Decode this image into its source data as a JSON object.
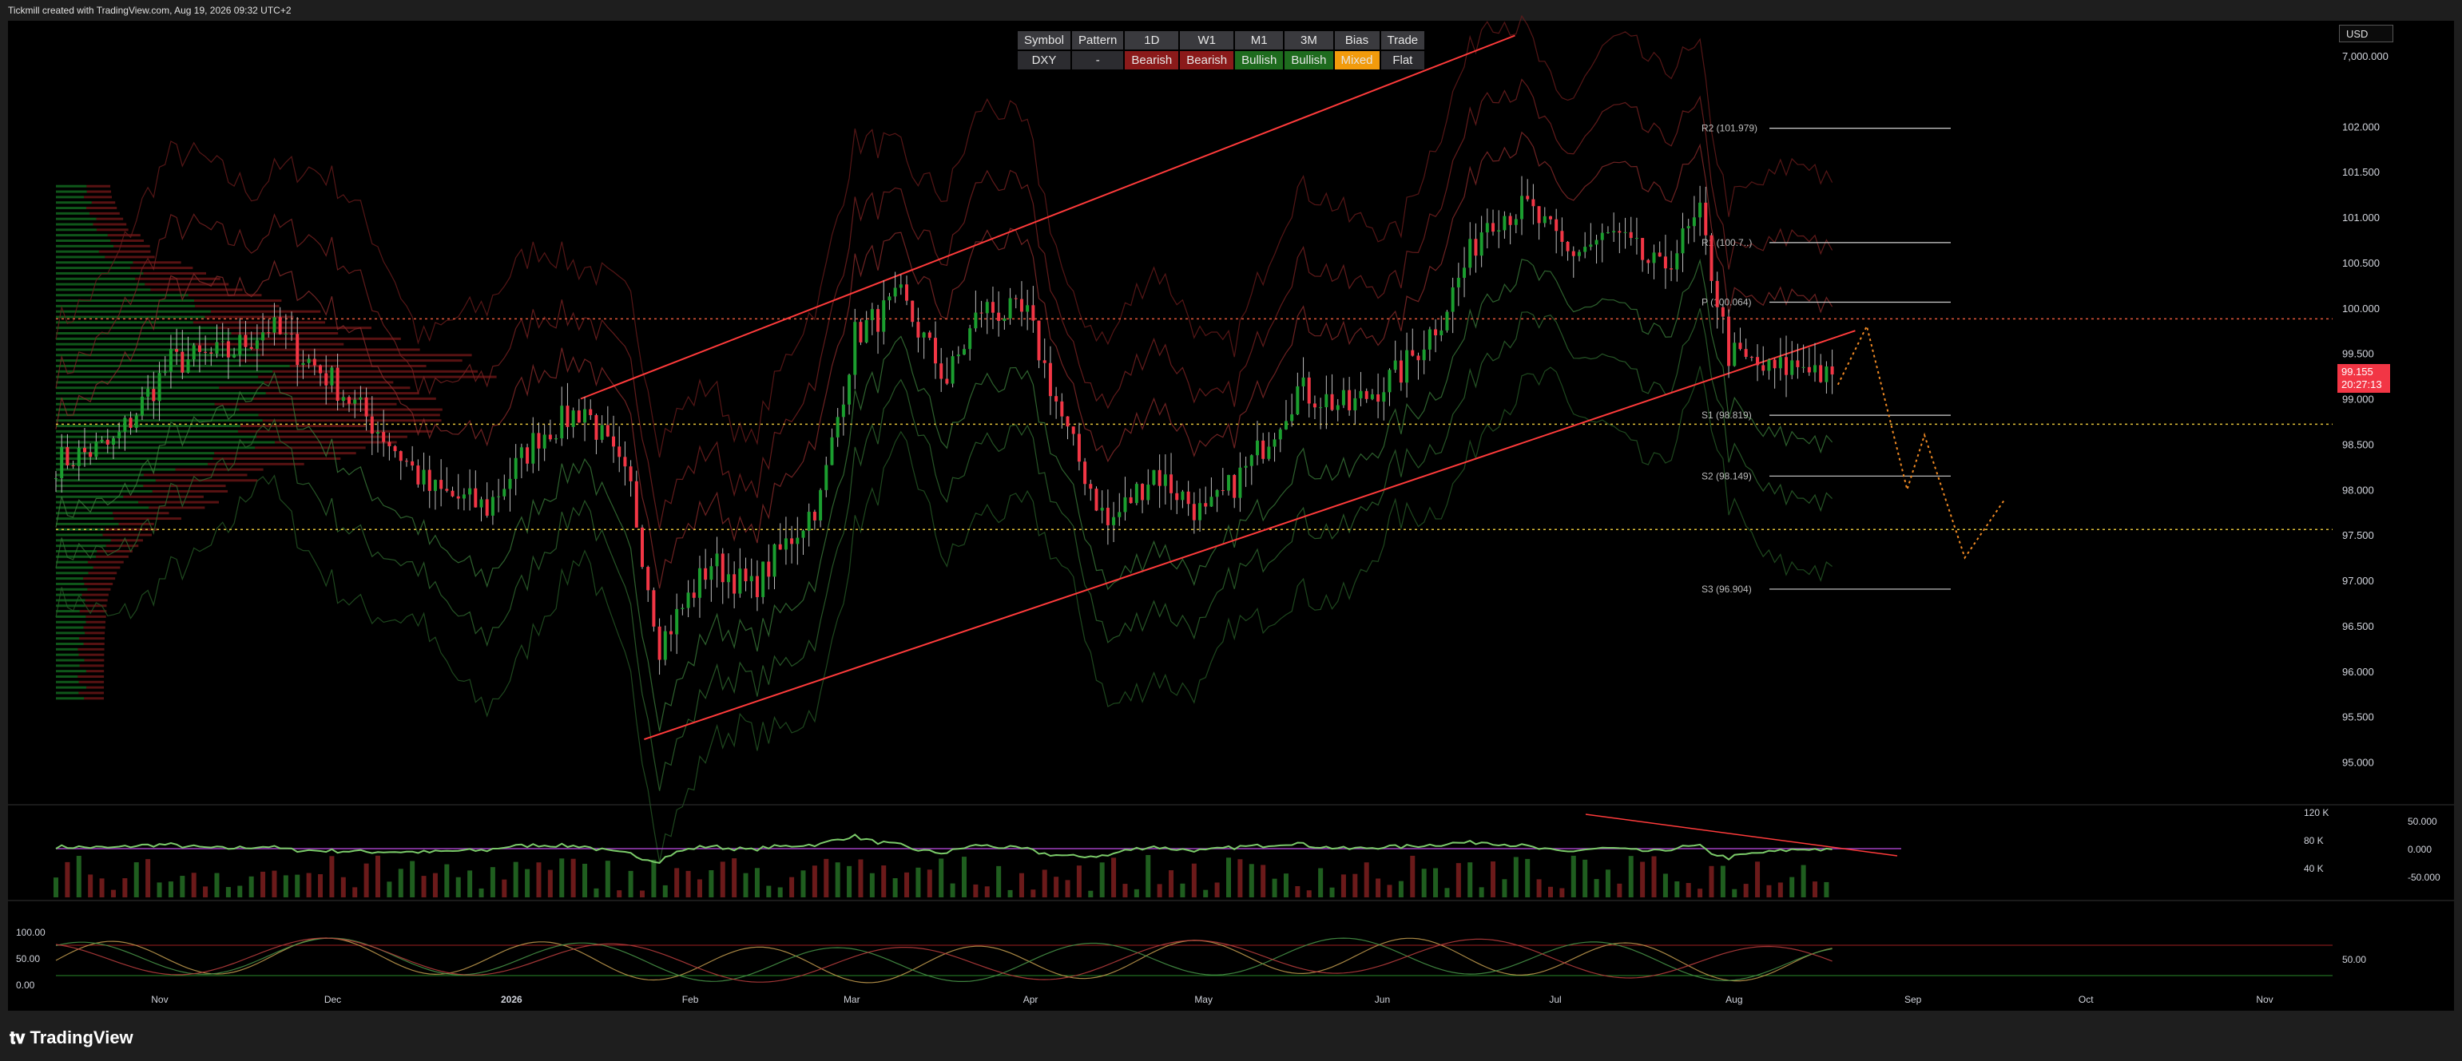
{
  "header": {
    "attribution": "Tickmill created with TradingView.com, Aug 19, 2026 09:32 UTC+2"
  },
  "footer": {
    "brand": "TradingView"
  },
  "currency_button": "USD",
  "last_price": {
    "value": "99.155",
    "countdown": "20:27:13"
  },
  "signal_table": {
    "headers": [
      "Symbol",
      "Pattern",
      "1D",
      "W1",
      "M1",
      "3M",
      "Bias",
      "Trade"
    ],
    "cells": [
      {
        "text": "DXY",
        "color": "#2c2c30"
      },
      {
        "text": "-",
        "color": "#2c2c30"
      },
      {
        "text": "Bearish",
        "color": "#8b1a1a"
      },
      {
        "text": "Bearish",
        "color": "#8b1a1a"
      },
      {
        "text": "Bullish",
        "color": "#1e6b1e"
      },
      {
        "text": "Bullish",
        "color": "#1e6b1e"
      },
      {
        "text": "Mixed",
        "color": "#f29b0c"
      },
      {
        "text": "Flat",
        "color": "#2c2c30"
      }
    ]
  },
  "colors": {
    "bull": "#1b9e2f",
    "bear": "#f23645",
    "trend": "#ff3b3b",
    "pivot": "#cfcfcf"
  },
  "chart_data": [
    {
      "type": "line",
      "ylim": [
        94.6,
        102.6
      ],
      "price_ticks": [
        "7,000.000",
        "102.000",
        "101.500",
        "101.000",
        "100.500",
        "100.000",
        "99.500",
        "99.000",
        "98.500",
        "98.000",
        "97.500",
        "97.000",
        "96.500",
        "96.000",
        "95.500",
        "95.000"
      ],
      "x_ticks": [
        "Nov",
        "Dec",
        "2026",
        "Feb",
        "Mar",
        "Apr",
        "May",
        "Jun",
        "Jul",
        "Aug",
        "Sep",
        "Oct",
        "Nov"
      ],
      "pivots": [
        {
          "label": "R2 (101.979)",
          "value": 101.979
        },
        {
          "label": "R1 (100.7..)",
          "value": 100.72
        },
        {
          "label": "P (100.064)",
          "value": 100.064
        },
        {
          "label": "S1 (98.819)",
          "value": 98.819
        },
        {
          "label": "S2 (98.149)",
          "value": 98.149
        },
        {
          "label": "S3 (96.904)",
          "value": 96.904
        }
      ],
      "horizontal_levels": [
        99.88,
        98.72,
        97.56
      ],
      "channel": {
        "upper": [
          [
            "2026-01-13",
            99.0
          ],
          [
            "2026-06-24",
            103.0
          ]
        ],
        "lower": [
          [
            "2026-01-24",
            95.25
          ],
          [
            "2026-08-22",
            99.75
          ]
        ]
      },
      "close_series": {
        "x": [
          "2025-10-14",
          "2025-10-24",
          "2025-11-03",
          "2025-11-13",
          "2025-11-20",
          "2025-12-01",
          "2025-12-10",
          "2025-12-18",
          "2025-12-28",
          "2026-01-06",
          "2026-01-14",
          "2026-01-22",
          "2026-01-27",
          "2026-02-05",
          "2026-02-12",
          "2026-02-24",
          "2026-03-02",
          "2026-03-10",
          "2026-03-18",
          "2026-03-24",
          "2026-04-01",
          "2026-04-08",
          "2026-04-15",
          "2026-04-23",
          "2026-05-02",
          "2026-05-10",
          "2026-05-18",
          "2026-05-27",
          "2026-06-05",
          "2026-06-12",
          "2026-06-20",
          "2026-06-27",
          "2026-07-04",
          "2026-07-12",
          "2026-07-20",
          "2026-07-27",
          "2026-08-01",
          "2026-08-08",
          "2026-08-15",
          "2026-08-19"
        ],
        "y": [
          98.3,
          98.5,
          99.4,
          99.5,
          99.8,
          99.2,
          98.6,
          98.0,
          97.8,
          98.6,
          98.9,
          98.0,
          96.3,
          97.2,
          96.9,
          97.9,
          99.7,
          100.1,
          99.2,
          100.0,
          99.9,
          98.6,
          97.6,
          98.2,
          97.7,
          98.3,
          99.1,
          98.9,
          99.3,
          99.9,
          101.0,
          101.1,
          100.6,
          100.8,
          100.4,
          101.0,
          99.5,
          99.3,
          99.4,
          99.155
        ]
      },
      "projection": [
        [
          "2026-08-19",
          99.155
        ],
        [
          "2026-08-24",
          99.8
        ],
        [
          "2026-08-31",
          98.0
        ],
        [
          "2026-09-03",
          98.6
        ],
        [
          "2026-09-10",
          97.25
        ],
        [
          "2026-09-17",
          97.9
        ]
      ]
    },
    {
      "type": "line",
      "title": "",
      "left_ticks": [
        "120 K",
        "80 K",
        "40 K"
      ],
      "right_ticks": [
        "50.000",
        "0.000",
        "-50.000"
      ],
      "ylim": [
        -80,
        80
      ]
    },
    {
      "type": "line",
      "left_ticks": [
        "100.00",
        "50.00",
        "0.00"
      ],
      "right_ticks": [
        "50.00"
      ],
      "ylim": [
        0,
        100
      ]
    }
  ]
}
